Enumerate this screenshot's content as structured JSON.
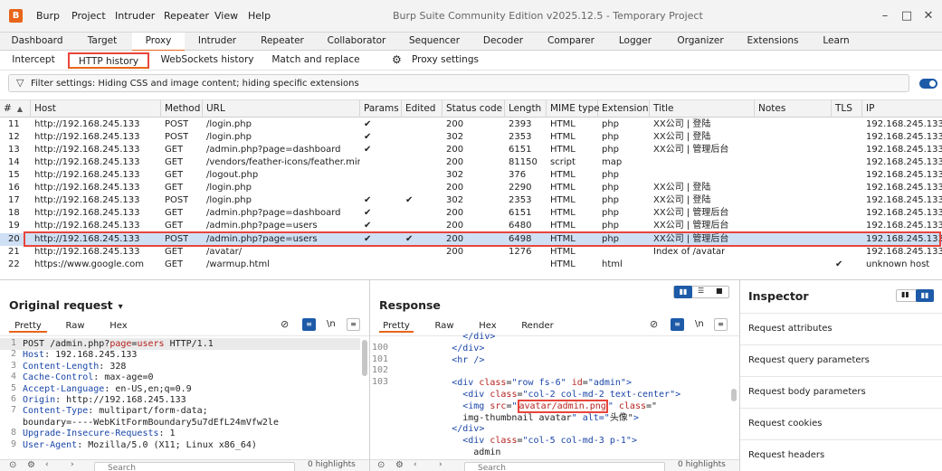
{
  "menubar": {
    "logo": "B",
    "items": [
      "Burp",
      "Project",
      "Intruder",
      "Repeater",
      "View",
      "Help"
    ],
    "title": "Burp Suite Community Edition v2025.12.5 - Temporary Project"
  },
  "main_tabs": [
    "Dashboard",
    "Target",
    "Proxy",
    "Intruder",
    "Repeater",
    "Collaborator",
    "Sequencer",
    "Decoder",
    "Comparer",
    "Logger",
    "Organizer",
    "Extensions",
    "Learn"
  ],
  "sub_tabs": [
    "Intercept",
    "HTTP history",
    "WebSockets history",
    "Match and replace",
    "Proxy settings"
  ],
  "filter": {
    "text": "Filter settings: Hiding CSS and image content; hiding specific extensions"
  },
  "columns": [
    "#",
    "Host",
    "Method",
    "URL",
    "Params",
    "Edited",
    "Status code",
    "Length",
    "MIME type",
    "Extension",
    "Title",
    "Notes",
    "TLS",
    "IP"
  ],
  "rows": [
    {
      "n": "11",
      "host": "http://192.168.245.133",
      "method": "POST",
      "url": "/login.php",
      "params": "✔",
      "edited": "",
      "status": "200",
      "length": "2393",
      "mime": "HTML",
      "ext": "php",
      "title": "XX公司 | 登陆",
      "tls": "",
      "ip": "192.168.245.133"
    },
    {
      "n": "12",
      "host": "http://192.168.245.133",
      "method": "POST",
      "url": "/login.php",
      "params": "✔",
      "edited": "",
      "status": "302",
      "length": "2353",
      "mime": "HTML",
      "ext": "php",
      "title": "XX公司 | 登陆",
      "tls": "",
      "ip": "192.168.245.133"
    },
    {
      "n": "13",
      "host": "http://192.168.245.133",
      "method": "GET",
      "url": "/admin.php?page=dashboard",
      "params": "✔",
      "edited": "",
      "status": "200",
      "length": "6151",
      "mime": "HTML",
      "ext": "php",
      "title": "XX公司 | 管理后台",
      "tls": "",
      "ip": "192.168.245.133"
    },
    {
      "n": "14",
      "host": "http://192.168.245.133",
      "method": "GET",
      "url": "/vendors/feather-icons/feather.min...",
      "params": "",
      "edited": "",
      "status": "200",
      "length": "81150",
      "mime": "script",
      "ext": "map",
      "title": "",
      "tls": "",
      "ip": "192.168.245.133"
    },
    {
      "n": "15",
      "host": "http://192.168.245.133",
      "method": "GET",
      "url": "/logout.php",
      "params": "",
      "edited": "",
      "status": "302",
      "length": "376",
      "mime": "HTML",
      "ext": "php",
      "title": "",
      "tls": "",
      "ip": "192.168.245.133"
    },
    {
      "n": "16",
      "host": "http://192.168.245.133",
      "method": "GET",
      "url": "/login.php",
      "params": "",
      "edited": "",
      "status": "200",
      "length": "2290",
      "mime": "HTML",
      "ext": "php",
      "title": "XX公司 | 登陆",
      "tls": "",
      "ip": "192.168.245.133"
    },
    {
      "n": "17",
      "host": "http://192.168.245.133",
      "method": "POST",
      "url": "/login.php",
      "params": "✔",
      "edited": "✔",
      "status": "302",
      "length": "2353",
      "mime": "HTML",
      "ext": "php",
      "title": "XX公司 | 登陆",
      "tls": "",
      "ip": "192.168.245.133"
    },
    {
      "n": "18",
      "host": "http://192.168.245.133",
      "method": "GET",
      "url": "/admin.php?page=dashboard",
      "params": "✔",
      "edited": "",
      "status": "200",
      "length": "6151",
      "mime": "HTML",
      "ext": "php",
      "title": "XX公司 | 管理后台",
      "tls": "",
      "ip": "192.168.245.133"
    },
    {
      "n": "19",
      "host": "http://192.168.245.133",
      "method": "GET",
      "url": "/admin.php?page=users",
      "params": "✔",
      "edited": "",
      "status": "200",
      "length": "6480",
      "mime": "HTML",
      "ext": "php",
      "title": "XX公司 | 管理后台",
      "tls": "",
      "ip": "192.168.245.133"
    },
    {
      "n": "20",
      "host": "http://192.168.245.133",
      "method": "POST",
      "url": "/admin.php?page=users",
      "params": "✔",
      "edited": "✔",
      "status": "200",
      "length": "6498",
      "mime": "HTML",
      "ext": "php",
      "title": "XX公司 | 管理后台",
      "tls": "",
      "ip": "192.168.245.133"
    },
    {
      "n": "21",
      "host": "http://192.168.245.133",
      "method": "GET",
      "url": "/avatar/",
      "params": "",
      "edited": "",
      "status": "200",
      "length": "1276",
      "mime": "HTML",
      "ext": "",
      "title": "Index of /avatar",
      "tls": "",
      "ip": "192.168.245.133"
    },
    {
      "n": "22",
      "host": "https://www.google.com",
      "method": "GET",
      "url": "/warmup.html",
      "params": "",
      "edited": "",
      "status": "",
      "length": "",
      "mime": "HTML",
      "ext": "html",
      "title": "",
      "tls": "✔",
      "ip": "unknown host"
    }
  ],
  "request": {
    "title": "Original request",
    "tabs": [
      "Pretty",
      "Raw",
      "Hex"
    ],
    "ln_label": "\\n",
    "lines": [
      {
        "n": "1",
        "parts": [
          [
            "",
            "POST /admin.php?"
          ],
          [
            "val",
            "page"
          ],
          [
            "",
            "="
          ],
          [
            "val",
            "users"
          ],
          [
            "",
            " HTTP/1.1"
          ]
        ]
      },
      {
        "n": "2",
        "parts": [
          [
            "kw",
            "Host"
          ],
          [
            "",
            ": 192.168.245.133"
          ]
        ]
      },
      {
        "n": "3",
        "parts": [
          [
            "kw",
            "Content-Length"
          ],
          [
            "",
            ": 328"
          ]
        ]
      },
      {
        "n": "4",
        "parts": [
          [
            "kw",
            "Cache-Control"
          ],
          [
            "",
            ": max-age=0"
          ]
        ]
      },
      {
        "n": "5",
        "parts": [
          [
            "kw",
            "Accept-Language"
          ],
          [
            "",
            ": en-US,en;q=0.9"
          ]
        ]
      },
      {
        "n": "6",
        "parts": [
          [
            "kw",
            "Origin"
          ],
          [
            "",
            ": http://192.168.245.133"
          ]
        ]
      },
      {
        "n": "7",
        "parts": [
          [
            "kw",
            "Content-Type"
          ],
          [
            "",
            ": multipart/form-data;"
          ]
        ]
      },
      {
        "n": "",
        "parts": [
          [
            "",
            "boundary=----WebKitFormBoundary5u7dEfL24mVfw2le"
          ]
        ]
      },
      {
        "n": "8",
        "parts": [
          [
            "kw",
            "Upgrade-Insecure-Requests"
          ],
          [
            "",
            ": 1"
          ]
        ]
      },
      {
        "n": "9",
        "parts": [
          [
            "kw",
            "User-Agent"
          ],
          [
            "",
            ": Mozilla/5.0 (X11; Linux x86_64)"
          ]
        ]
      }
    ]
  },
  "response": {
    "title": "Response",
    "tabs": [
      "Pretty",
      "Raw",
      "Hex",
      "Render"
    ],
    "ln_label": "\\n",
    "lines": [
      {
        "n": "",
        "text": "            </div>"
      },
      {
        "n": "100",
        "text": "          </div>"
      },
      {
        "n": "101",
        "text": "          <hr />"
      },
      {
        "n": "102",
        "text": ""
      },
      {
        "n": "103",
        "text": "          <div class=\"row fs-6\" id=\"admin\">"
      },
      {
        "n": "",
        "text": "            <div class=\"col-2 col-md-2 text-center\">"
      },
      {
        "n": "",
        "text": "            <img src=\"avatar/admin.png\" class=\""
      },
      {
        "n": "",
        "text": "            img-thumbnail avatar\" alt=\"头像\">"
      },
      {
        "n": "",
        "text": "          </div>"
      },
      {
        "n": "",
        "text": "            <div class=\"col-5 col-md-3 p-1\">"
      },
      {
        "n": "",
        "text": "              admin"
      }
    ],
    "highlight": "avatar/admin.png"
  },
  "inspector": {
    "title": "Inspector",
    "items": [
      "Request attributes",
      "Request query parameters",
      "Request body parameters",
      "Request cookies",
      "Request headers"
    ]
  },
  "footer": {
    "search_placeholder": "Search",
    "highlights": "0 highlights"
  }
}
